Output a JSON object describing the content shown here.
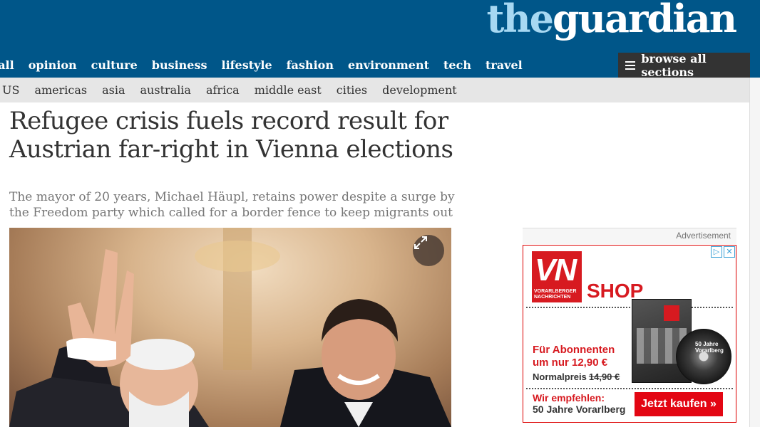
{
  "logo": {
    "part1": "the",
    "part2": "guardian"
  },
  "nav": {
    "items": [
      "ball",
      "opinion",
      "culture",
      "business",
      "lifestyle",
      "fashion",
      "environment",
      "tech",
      "travel"
    ],
    "browse_label": "browse all sections"
  },
  "subnav": {
    "items": [
      "US",
      "americas",
      "asia",
      "australia",
      "africa",
      "middle east",
      "cities",
      "development"
    ]
  },
  "article": {
    "headline": "Refugee crisis fuels record result for Austrian far-right in Vienna elections",
    "standfirst": "The mayor of 20 years, Michael Häupl, retains power despite a surge by the Freedom party which called for a border fence to keep migrants out"
  },
  "advert": {
    "label": "Advertisement",
    "choices_icons": [
      "info-icon",
      "close-icon"
    ],
    "logo_letters": "VN",
    "logo_text": "VORARLBERGER NACHRICHTEN",
    "shop": "SHOP",
    "offer_line1": "Für Abonnenten",
    "offer_line2": "um nur 12,90 €",
    "normal_label": "Normalpreis",
    "normal_price": "14,90 €",
    "disc_text": "50 Jahre Vorarlberg",
    "recommend": "Wir empfehlen:",
    "recommend_title": "50 Jahre Vorarlberg",
    "button": "Jetzt kaufen »"
  },
  "colors": {
    "brand": "#005689",
    "brand_light": "#a7d8f2",
    "ad_red": "#d71a20"
  }
}
